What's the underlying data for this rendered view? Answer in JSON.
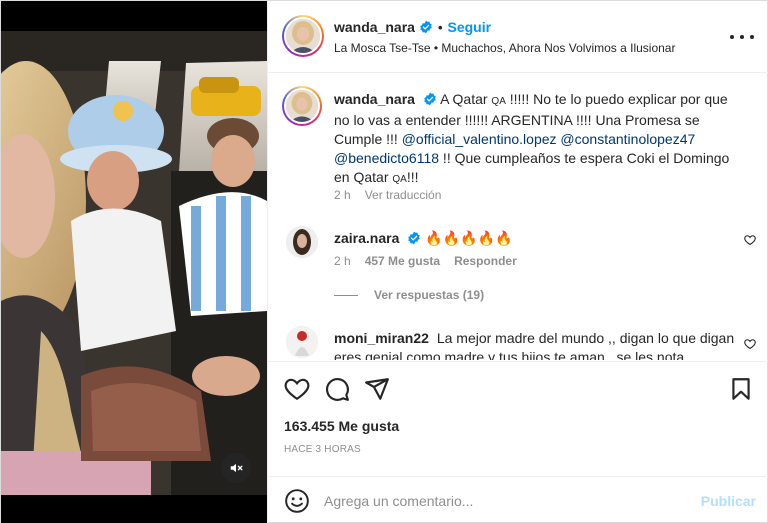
{
  "post": {
    "author": "wanda_nara",
    "follow_label": "Seguir",
    "audio_line": "La Mosca Tse-Tse • Muchachos, Ahora Nos Volvimos a Ilusionar",
    "more_icon": "more-options-icon"
  },
  "caption": {
    "author": "wanda_nara",
    "text_1": "A Qatar",
    "qa_1": "QA",
    "text_2": " !!!!! No te lo puedo explicar por que no lo vas a entender !!!!!! ARGENTINA !!!! Una Promesa se Cumple !!! ",
    "mention_1": "@official_valentino.lopez",
    "mention_2": "@constantinolopez47",
    "mention_3": "@benedicto6118",
    "text_3": " !! Que cumpleaños te espera Coki el Domingo en Qatar",
    "qa_2": "QA",
    "text_4": "!!!",
    "time": "2 h",
    "translate": "Ver traducción"
  },
  "comments": [
    {
      "author": "zaira.nara",
      "text": "🔥🔥🔥🔥🔥",
      "time": "2 h",
      "likes": "457 Me gusta",
      "reply": "Responder",
      "view_replies": "Ver respuestas (19)"
    },
    {
      "author": "moni_miran22",
      "text": "La mejor madre del mundo ,, digan lo que digan eres genial como madre y tus hijos te aman , se les nota"
    }
  ],
  "actions": {
    "like_icon": "heart-icon",
    "comment_icon": "comment-icon",
    "share_icon": "send-icon",
    "save_icon": "bookmark-icon",
    "likes": "163.455 Me gusta",
    "time": "HACE 3 HORAS"
  },
  "composer": {
    "placeholder": "Agrega un comentario...",
    "publish_label": "Publicar"
  },
  "colors": {
    "accent": "#0095f6",
    "publish_disabled": "#b2dffc",
    "verified": "#0095f6",
    "mention": "#00376b"
  }
}
